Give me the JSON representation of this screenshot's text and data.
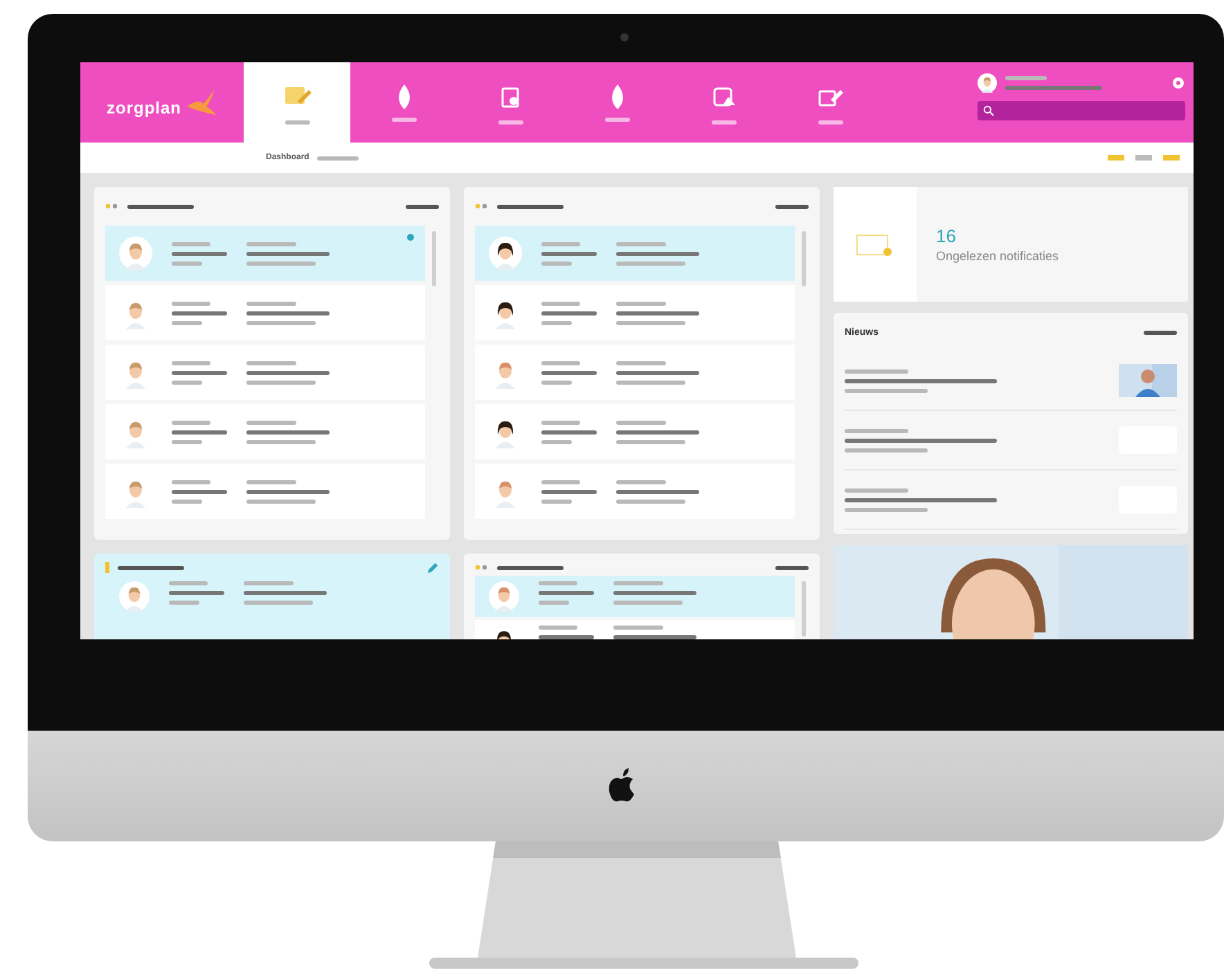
{
  "logo": "zorgplan",
  "nav": [
    {
      "kind": "note",
      "selected": true
    },
    {
      "kind": "drop",
      "selected": false
    },
    {
      "kind": "doc",
      "selected": false
    },
    {
      "kind": "drop",
      "selected": false
    },
    {
      "kind": "chart",
      "selected": false
    },
    {
      "kind": "pen",
      "selected": false
    }
  ],
  "breadcrumb": "Dashboard",
  "lists": [
    {
      "kind": "plain",
      "rows": [
        {
          "kind": "man",
          "selected": true,
          "unread": true
        },
        {
          "kind": "man",
          "selected": false,
          "unread": false
        },
        {
          "kind": "man",
          "selected": false,
          "unread": false
        },
        {
          "kind": "man",
          "selected": false,
          "unread": false
        },
        {
          "kind": "man",
          "selected": false,
          "unread": false
        }
      ]
    },
    {
      "kind": "plain",
      "rows": [
        {
          "kind": "dark",
          "selected": true,
          "unread": false
        },
        {
          "kind": "dark",
          "selected": false,
          "unread": false
        },
        {
          "kind": "light",
          "selected": false,
          "unread": false
        },
        {
          "kind": "dark",
          "selected": false,
          "unread": false
        },
        {
          "kind": "light",
          "selected": false,
          "unread": false
        }
      ]
    },
    {
      "kind": "tinted",
      "rows": [
        {
          "kind": "man",
          "selected": false,
          "unread": false
        }
      ]
    },
    {
      "kind": "plain",
      "rows": [
        {
          "kind": "light",
          "selected": true,
          "unread": false
        },
        {
          "kind": "dark",
          "selected": false,
          "unread": false
        }
      ]
    }
  ],
  "notifications": {
    "count": "16",
    "label": "Ongelezen notificaties"
  },
  "news": {
    "title": "Nieuws",
    "items": [
      {
        "picture": true
      },
      {
        "picture": false
      },
      {
        "picture": false
      }
    ]
  }
}
